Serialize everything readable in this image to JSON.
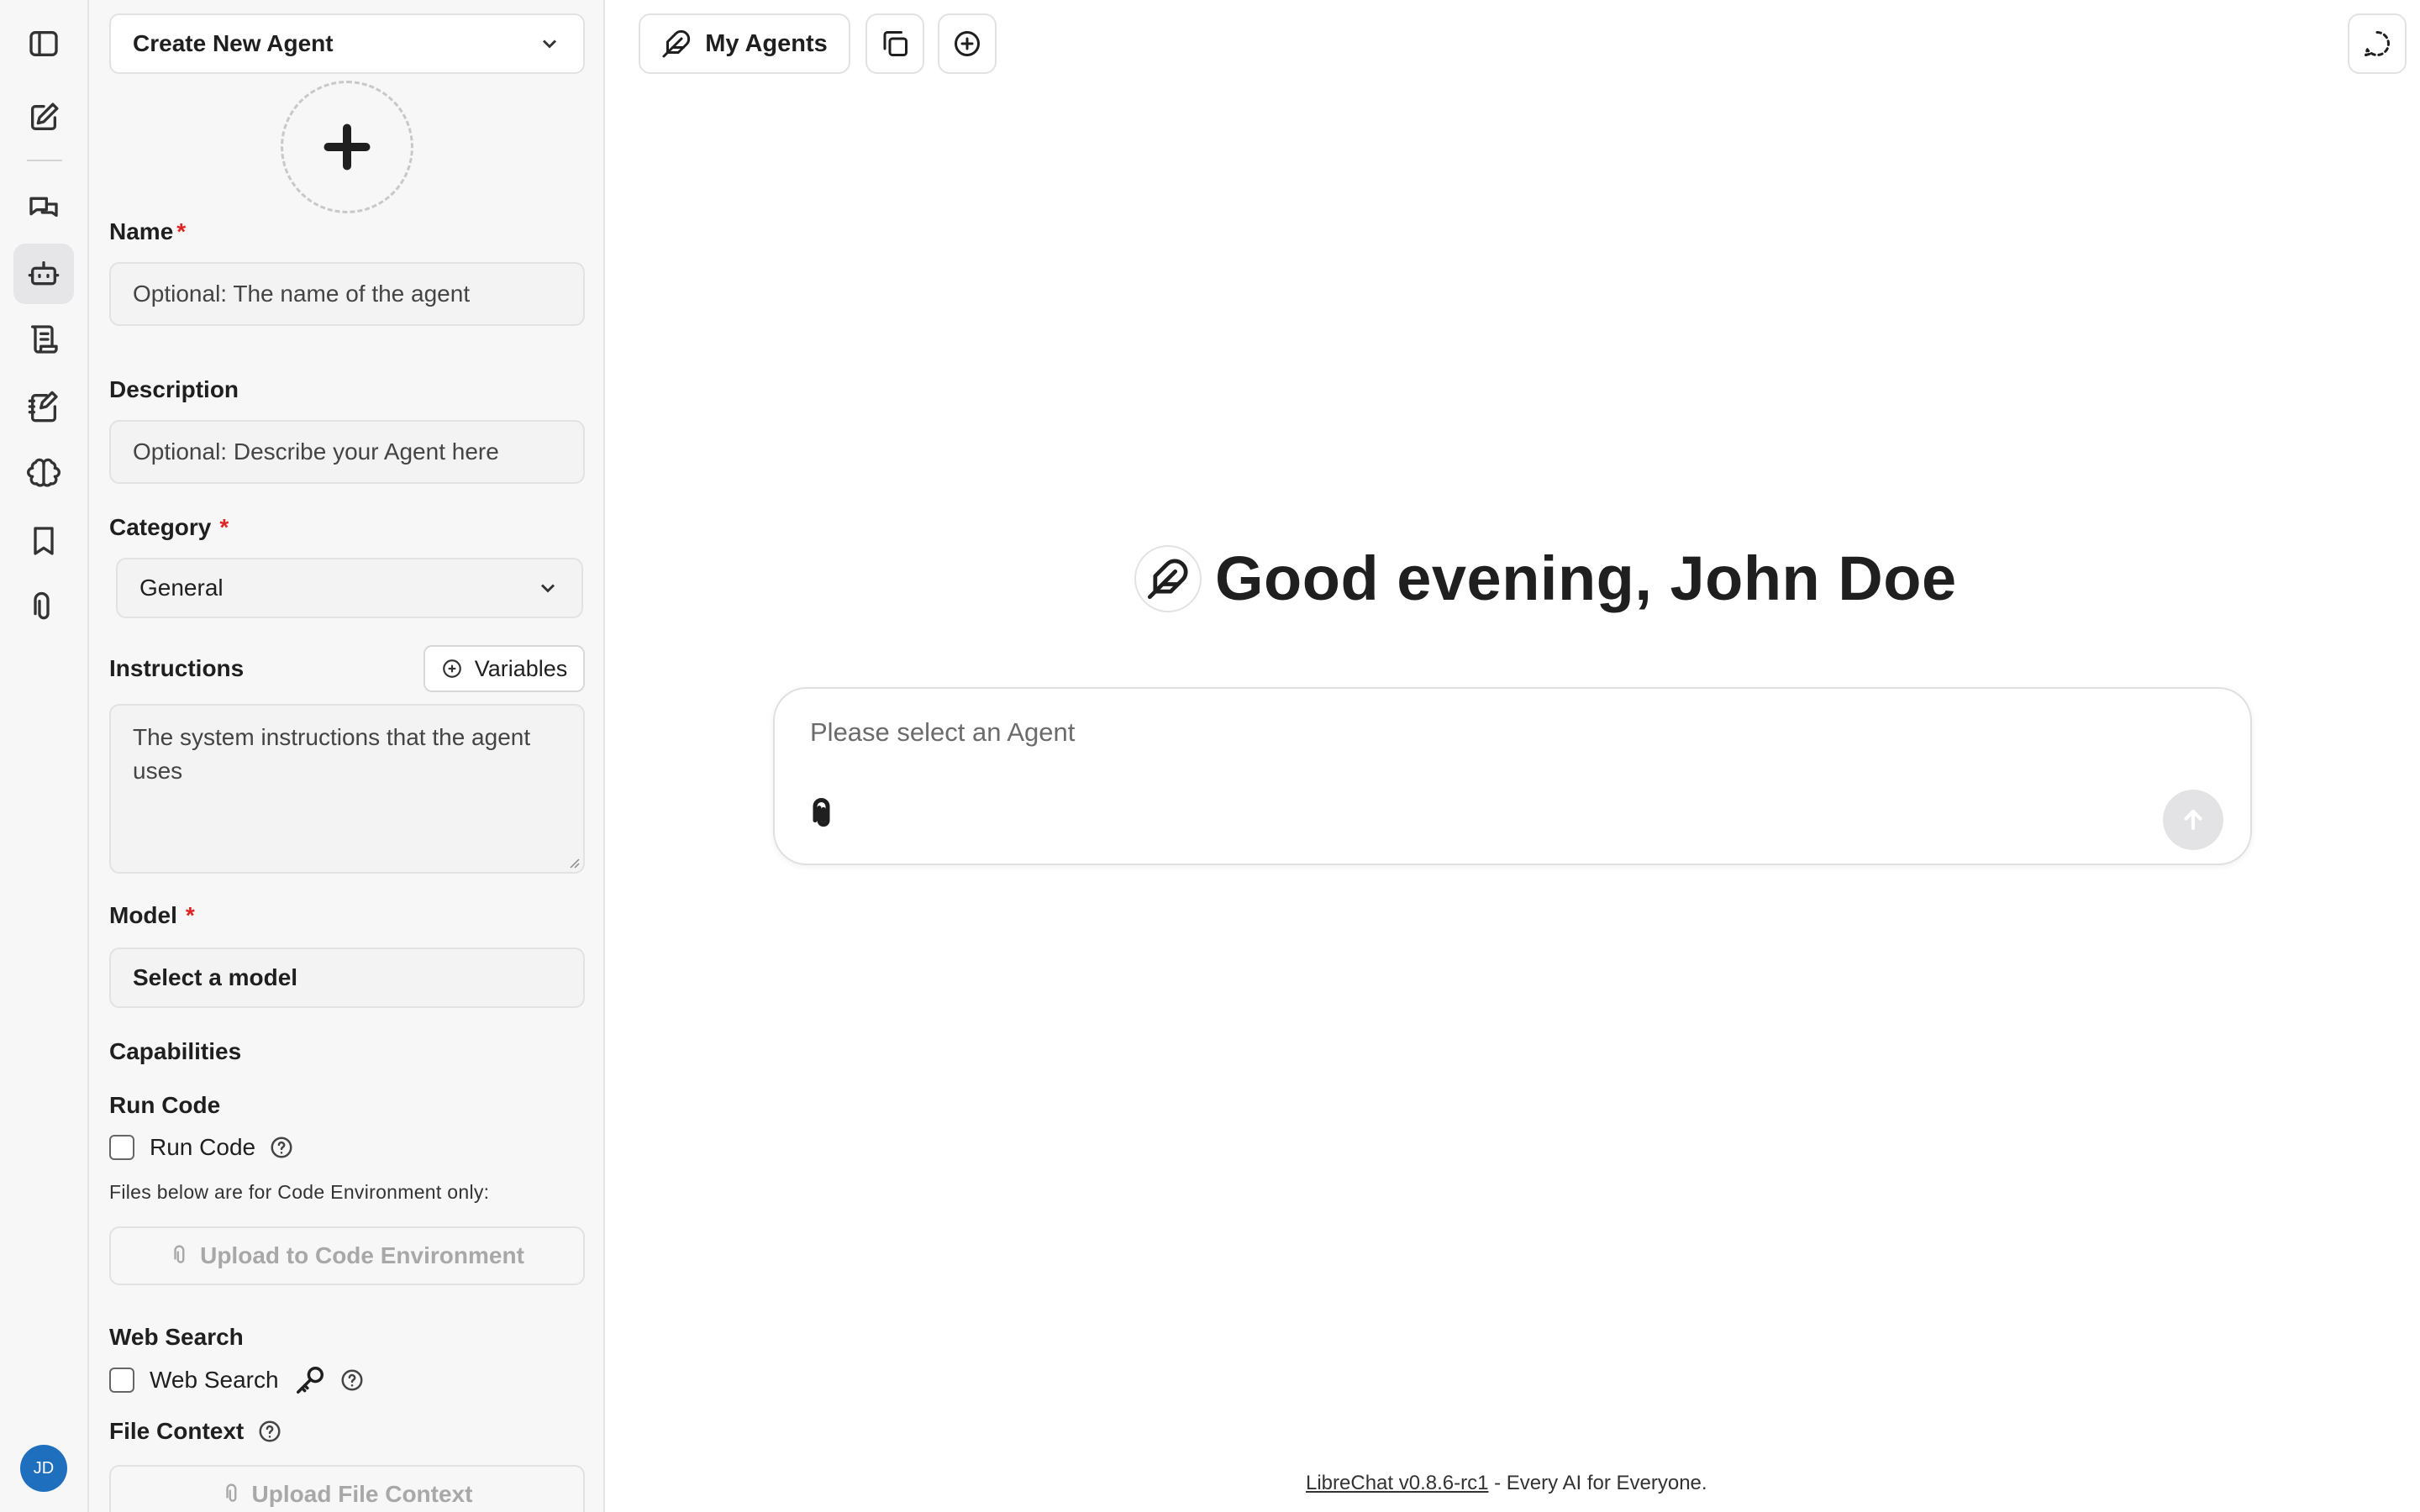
{
  "rail": {
    "items": [
      "toggle-sidebar",
      "new-chat",
      "conversations",
      "agents",
      "prompts",
      "notes",
      "memories",
      "bookmarks",
      "attachments"
    ],
    "active": "agents",
    "avatar_initials": "JD",
    "avatar_color": "#1e6fbd"
  },
  "panel": {
    "mode_select": "Create New Agent",
    "name": {
      "label": "Name",
      "required": "*",
      "placeholder": "Optional: The name of the agent"
    },
    "description": {
      "label": "Description",
      "placeholder": "Optional: Describe your Agent here"
    },
    "category": {
      "label": "Category",
      "required": "*",
      "value": "General"
    },
    "instructions": {
      "label": "Instructions",
      "variables_label": "Variables",
      "placeholder": "The system instructions that the agent uses"
    },
    "model": {
      "label": "Model",
      "required": "*",
      "value": "Select a model"
    },
    "capabilities": {
      "title": "Capabilities",
      "run_code": {
        "section": "Run Code",
        "checkbox_label": "Run Code",
        "note": "Files below are for Code Environment only:",
        "upload_label": "Upload to Code Environment"
      },
      "web_search": {
        "section": "Web Search",
        "checkbox_label": "Web Search"
      },
      "file_context": {
        "section": "File Context",
        "upload_label": "Upload File Context"
      }
    }
  },
  "topbar": {
    "my_agents_label": "My Agents"
  },
  "main": {
    "greeting": "Good evening, John Doe",
    "composer_placeholder": "Please select an Agent"
  },
  "footer": {
    "link_text": "LibreChat v0.8.6-rc1",
    "tagline": " - Every AI for Everyone."
  },
  "colors": {
    "required": "#e02424",
    "panel_bg": "#f7f7f8",
    "send_disabled": "#e3e3e5"
  }
}
